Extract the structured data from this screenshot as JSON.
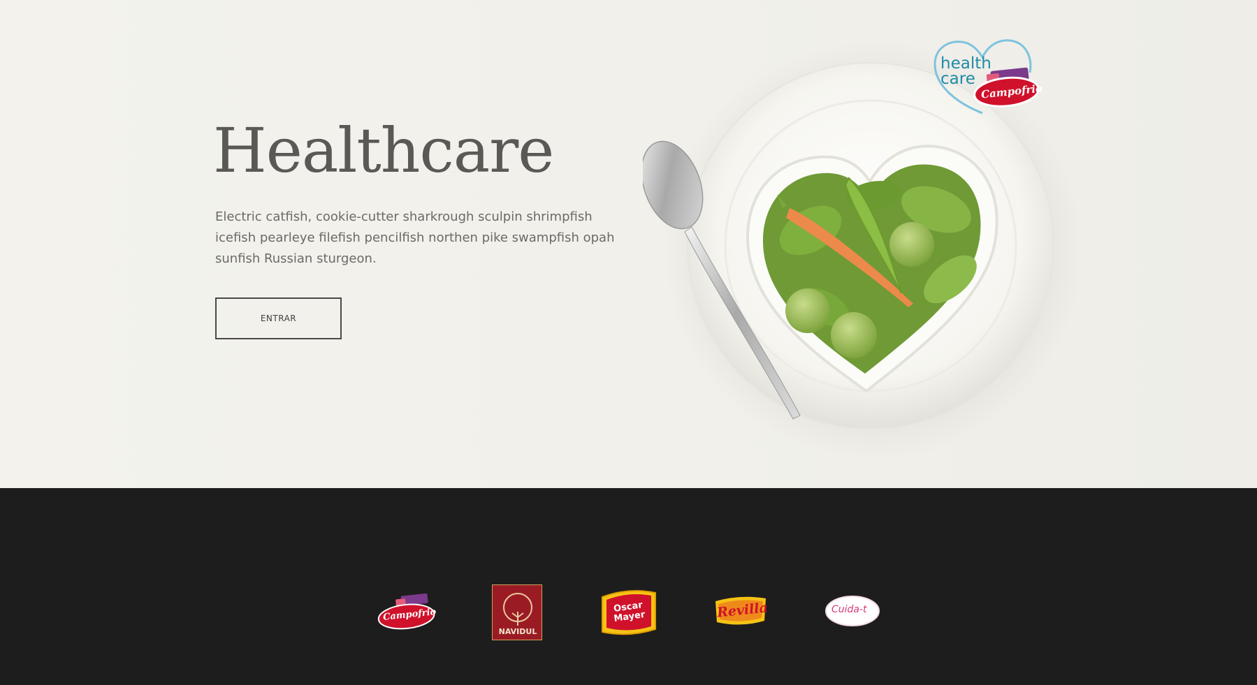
{
  "hero": {
    "title": "Healthcare",
    "description": "Electric catfish, cookie-cutter sharkrough sculpin shrimpfish icefish pearleye filefish pencilfish northen pike swampfish opah sunfish Russian sturgeon.",
    "enter_label": "ENTRAR"
  },
  "logo": {
    "word1": "health",
    "word2": "care",
    "brand": "Campofrio"
  },
  "footer": {
    "brands": [
      {
        "label": "Campofrio",
        "icon": "campofrio-logo"
      },
      {
        "label": "NAVIDUL",
        "icon": "navidul-logo"
      },
      {
        "label": "Oscar Mayer",
        "icon": "oscar-mayer-logo"
      },
      {
        "label": "Revilla",
        "icon": "revilla-logo"
      },
      {
        "label": "Cuida-t",
        "icon": "cuida-t-logo"
      }
    ]
  },
  "colors": {
    "hero_bg": "#f2f1ec",
    "footer_bg": "#1e1d1d",
    "title_text": "#5a5956",
    "campofrio_red": "#d0112b",
    "healthcare_blue": "#1f8aa8"
  }
}
